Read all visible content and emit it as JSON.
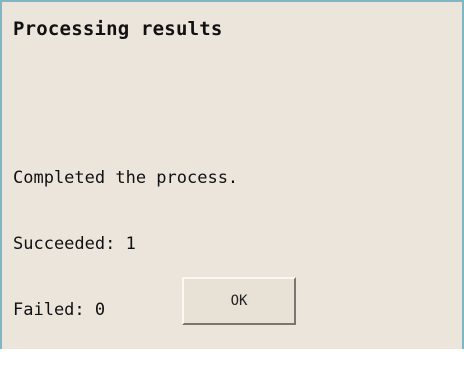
{
  "dialog": {
    "title": "Processing results",
    "message_lines": [
      "Completed the process.",
      "Succeeded: 1",
      "Failed: 0"
    ],
    "ok_label": "OK"
  },
  "colors": {
    "background": "#ece5db",
    "border": "#7fb6c2",
    "button_face": "#e8e1d6",
    "text": "#111111"
  }
}
